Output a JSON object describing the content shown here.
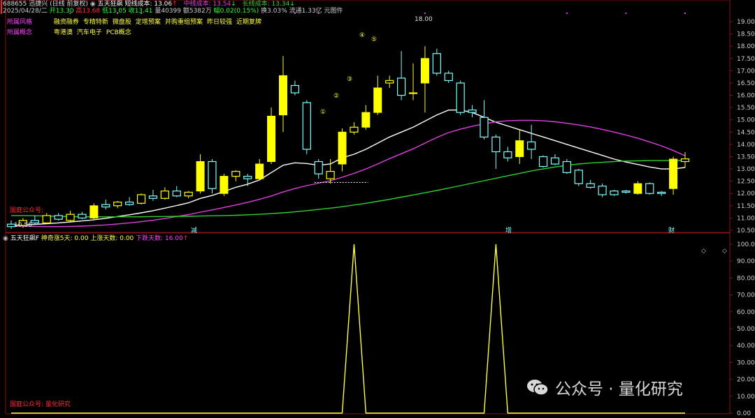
{
  "header": {
    "code_name": "688655 迅捷兴 (日线 前复权)",
    "indicator": "五天狂飙",
    "line_label": "短线成本: 13.06",
    "line_label_arrow": "↑",
    "mid_label": "中线成本: 13.54",
    "mid_arrow": "↓",
    "long_label": "长线成本: 13.34",
    "long_arrow": "↓",
    "date": "2025/04/28/二",
    "open": "开13.30",
    "high": "高13.68",
    "low": "低13.05",
    "close": "收13.41",
    "volume": "量40399",
    "amount": "额5382万",
    "change": "幅0.02(0.15%)",
    "turnover": "换3.03%",
    "float_cap": "流通1.33亿 元图件"
  },
  "tags": {
    "style_label": "所属风格",
    "style_items": [
      "融资融券",
      "专精特新",
      "微盘股",
      "定增预案",
      "并购重组预案",
      "昨日较强",
      "近期复牌"
    ],
    "concept_label": "所属概念",
    "concept_items": [
      "粤港澳",
      "汽车电子",
      "PCB概念"
    ]
  },
  "sub_header": {
    "title": "五天狂飙F",
    "f1": "神奇涨5天: 0.00",
    "f2": "上涨天数: 0.00",
    "f3": "下跌天数: 16.00",
    "f3_arrow": "↑"
  },
  "annotations": {
    "peak_price": "18.00",
    "low_price": "10.56",
    "left_watermark": "国庭公众号:",
    "marker_a": "减",
    "marker_b": "增",
    "marker_c": "财",
    "sub_footer": "国庭公众号: 量化研究",
    "watermark": "公众号 · 量化研究",
    "nav_left": "◇",
    "nav_right": "◇",
    "circled_1": "①",
    "circled_2": "②",
    "circled_3": "③",
    "circled_4": "④",
    "circled_5": "⑤"
  },
  "colors": {
    "up": "#ffff00",
    "down": "#7fffff",
    "short_line": "#ffffff",
    "mid_line": "#e040e0",
    "long_line": "#30d030",
    "sub_line": "#ffff40",
    "axis_text": "#cfcfcf",
    "tag_label": "#ff40ff",
    "tag_text": "#ffff40",
    "grid": "#8a1010"
  },
  "chart_data": [
    {
      "type": "candlestick",
      "title": "688655 迅捷兴 (日线 前复权)",
      "ylim": [
        10.5,
        19.2
      ],
      "y_ticks": [
        10.5,
        11.0,
        11.5,
        12.0,
        12.5,
        13.0,
        13.5,
        14.0,
        14.5,
        15.0,
        15.5,
        16.0,
        16.5,
        17.0,
        17.5,
        18.0,
        18.5,
        19.0
      ],
      "y_tick_labels": [
        "10.50",
        "11.00",
        "11.50",
        "12.00",
        "12.50",
        "13.00",
        "13.50",
        "14.00",
        "14.50",
        "15.00",
        "15.50",
        "16.00",
        "16.50",
        "17.00",
        "17.50",
        "18.00",
        "18.50",
        "19.00"
      ],
      "ohlc": [
        {
          "o": 10.75,
          "h": 10.9,
          "l": 10.56,
          "c": 10.65
        },
        {
          "o": 10.7,
          "h": 11.0,
          "l": 10.6,
          "c": 10.9
        },
        {
          "o": 10.9,
          "h": 11.1,
          "l": 10.75,
          "c": 10.8
        },
        {
          "o": 10.8,
          "h": 11.2,
          "l": 10.75,
          "c": 11.1
        },
        {
          "o": 11.1,
          "h": 11.2,
          "l": 10.9,
          "c": 10.95
        },
        {
          "o": 10.9,
          "h": 11.3,
          "l": 10.85,
          "c": 11.15
        },
        {
          "o": 11.15,
          "h": 11.25,
          "l": 10.95,
          "c": 11.0
        },
        {
          "o": 11.0,
          "h": 11.6,
          "l": 10.95,
          "c": 11.5
        },
        {
          "o": 11.55,
          "h": 11.75,
          "l": 11.35,
          "c": 11.45
        },
        {
          "o": 11.5,
          "h": 11.7,
          "l": 11.4,
          "c": 11.65
        },
        {
          "o": 11.65,
          "h": 11.85,
          "l": 11.5,
          "c": 11.55
        },
        {
          "o": 11.6,
          "h": 12.0,
          "l": 11.55,
          "c": 11.95
        },
        {
          "o": 11.9,
          "h": 12.15,
          "l": 11.7,
          "c": 11.8
        },
        {
          "o": 11.8,
          "h": 12.25,
          "l": 11.75,
          "c": 12.1
        },
        {
          "o": 12.1,
          "h": 12.3,
          "l": 11.85,
          "c": 11.9
        },
        {
          "o": 11.9,
          "h": 12.1,
          "l": 11.8,
          "c": 12.05
        },
        {
          "o": 12.1,
          "h": 13.6,
          "l": 12.0,
          "c": 13.3
        },
        {
          "o": 13.3,
          "h": 13.4,
          "l": 12.0,
          "c": 12.2
        },
        {
          "o": 12.0,
          "h": 12.8,
          "l": 11.9,
          "c": 12.7
        },
        {
          "o": 12.7,
          "h": 12.95,
          "l": 12.5,
          "c": 12.9
        },
        {
          "o": 12.7,
          "h": 12.8,
          "l": 12.3,
          "c": 12.6
        },
        {
          "o": 12.6,
          "h": 13.4,
          "l": 12.55,
          "c": 13.2
        },
        {
          "o": 13.3,
          "h": 15.5,
          "l": 13.2,
          "c": 15.15
        },
        {
          "o": 15.2,
          "h": 17.6,
          "l": 14.5,
          "c": 16.8
        },
        {
          "o": 16.4,
          "h": 16.6,
          "l": 16.0,
          "c": 16.1
        },
        {
          "o": 15.7,
          "h": 15.8,
          "l": 13.6,
          "c": 13.8
        },
        {
          "o": 13.3,
          "h": 13.4,
          "l": 12.6,
          "c": 12.8
        },
        {
          "o": 12.6,
          "h": 13.4,
          "l": 12.4,
          "c": 12.9
        },
        {
          "o": 13.2,
          "h": 14.65,
          "l": 12.9,
          "c": 14.5
        },
        {
          "o": 14.5,
          "h": 14.9,
          "l": 14.4,
          "c": 14.7
        },
        {
          "o": 14.7,
          "h": 15.6,
          "l": 14.6,
          "c": 15.3
        },
        {
          "o": 15.3,
          "h": 16.8,
          "l": 15.2,
          "c": 16.3
        },
        {
          "o": 16.5,
          "h": 16.8,
          "l": 16.3,
          "c": 16.6
        },
        {
          "o": 16.7,
          "h": 17.8,
          "l": 15.8,
          "c": 16.0
        },
        {
          "o": 16.1,
          "h": 17.3,
          "l": 15.8,
          "c": 16.1
        },
        {
          "o": 16.5,
          "h": 18.0,
          "l": 15.3,
          "c": 17.5
        },
        {
          "o": 17.7,
          "h": 17.9,
          "l": 16.8,
          "c": 16.9
        },
        {
          "o": 16.9,
          "h": 17.0,
          "l": 16.5,
          "c": 16.6
        },
        {
          "o": 16.5,
          "h": 16.6,
          "l": 15.2,
          "c": 15.3
        },
        {
          "o": 15.4,
          "h": 15.6,
          "l": 15.1,
          "c": 15.3
        },
        {
          "o": 15.1,
          "h": 15.8,
          "l": 14.2,
          "c": 14.3
        },
        {
          "o": 14.3,
          "h": 14.4,
          "l": 13.0,
          "c": 13.7
        },
        {
          "o": 13.7,
          "h": 13.9,
          "l": 13.3,
          "c": 13.45
        },
        {
          "o": 13.5,
          "h": 14.6,
          "l": 13.2,
          "c": 14.15
        },
        {
          "o": 14.1,
          "h": 14.8,
          "l": 13.4,
          "c": 13.8
        },
        {
          "o": 13.5,
          "h": 13.55,
          "l": 13.05,
          "c": 13.1
        },
        {
          "o": 13.45,
          "h": 13.6,
          "l": 13.15,
          "c": 13.2
        },
        {
          "o": 13.3,
          "h": 13.4,
          "l": 12.8,
          "c": 12.85
        },
        {
          "o": 12.95,
          "h": 13.0,
          "l": 12.3,
          "c": 12.4
        },
        {
          "o": 12.4,
          "h": 12.55,
          "l": 12.2,
          "c": 12.25
        },
        {
          "o": 12.3,
          "h": 12.4,
          "l": 11.85,
          "c": 11.95
        },
        {
          "o": 12.1,
          "h": 12.15,
          "l": 11.9,
          "c": 11.95
        },
        {
          "o": 12.1,
          "h": 12.15,
          "l": 12.0,
          "c": 12.05
        },
        {
          "o": 12.0,
          "h": 12.5,
          "l": 11.95,
          "c": 12.4
        },
        {
          "o": 12.4,
          "h": 12.45,
          "l": 11.95,
          "c": 12.0
        },
        {
          "o": 12.05,
          "h": 12.1,
          "l": 11.9,
          "c": 12.0
        },
        {
          "o": 12.2,
          "h": 13.5,
          "l": 11.95,
          "c": 13.4
        },
        {
          "o": 13.3,
          "h": 13.68,
          "l": 13.05,
          "c": 13.41
        }
      ],
      "series": [
        {
          "name": "短线成本",
          "values": [
            10.7,
            10.72,
            10.74,
            10.77,
            10.8,
            10.84,
            10.88,
            10.93,
            10.99,
            11.06,
            11.13,
            11.21,
            11.3,
            11.4,
            11.51,
            11.62,
            11.8,
            11.92,
            12.08,
            12.25,
            12.38,
            12.55,
            12.85,
            13.15,
            13.25,
            13.22,
            13.15,
            13.2,
            13.45,
            13.6,
            13.8,
            14.05,
            14.3,
            14.5,
            14.7,
            14.95,
            15.2,
            15.4,
            15.4,
            15.3,
            15.1,
            14.9,
            14.75,
            14.6,
            14.45,
            14.3,
            14.15,
            14.0,
            13.85,
            13.7,
            13.55,
            13.4,
            13.28,
            13.18,
            13.08,
            13.0,
            13.0,
            13.06
          ]
        },
        {
          "name": "中线成本",
          "values": [
            10.68,
            10.67,
            10.66,
            10.65,
            10.65,
            10.66,
            10.67,
            10.69,
            10.72,
            10.76,
            10.8,
            10.85,
            10.91,
            10.98,
            11.06,
            11.14,
            11.24,
            11.33,
            11.43,
            11.53,
            11.64,
            11.76,
            11.9,
            12.06,
            12.2,
            12.32,
            12.42,
            12.52,
            12.66,
            12.82,
            13.0,
            13.2,
            13.42,
            13.62,
            13.82,
            14.05,
            14.28,
            14.48,
            14.62,
            14.74,
            14.84,
            14.92,
            14.96,
            14.98,
            14.98,
            14.96,
            14.92,
            14.86,
            14.79,
            14.71,
            14.61,
            14.5,
            14.38,
            14.25,
            14.1,
            13.94,
            13.75,
            13.54
          ]
        },
        {
          "name": "长线成本",
          "values": [
            11.1,
            11.1,
            11.09,
            11.08,
            11.07,
            11.06,
            11.05,
            11.05,
            11.05,
            11.05,
            11.05,
            11.05,
            11.06,
            11.06,
            11.07,
            11.07,
            11.08,
            11.09,
            11.1,
            11.11,
            11.13,
            11.15,
            11.18,
            11.21,
            11.25,
            11.3,
            11.35,
            11.4,
            11.46,
            11.53,
            11.6,
            11.68,
            11.76,
            11.85,
            11.94,
            12.03,
            12.12,
            12.22,
            12.32,
            12.42,
            12.52,
            12.62,
            12.72,
            12.82,
            12.92,
            13.0,
            13.08,
            13.14,
            13.2,
            13.24,
            13.27,
            13.3,
            13.32,
            13.33,
            13.34,
            13.34,
            13.34,
            13.34
          ]
        }
      ]
    },
    {
      "type": "line",
      "title": "五天狂飙F",
      "ylim": [
        0,
        100
      ],
      "y_ticks": [
        0,
        10,
        20,
        30,
        40,
        50,
        60,
        70,
        80,
        90,
        100
      ],
      "y_tick_labels": [
        "0.00",
        "10.00",
        "20.00",
        "30.00",
        "40.00",
        "50.00",
        "60.00",
        "70.00",
        "80.00",
        "90.00",
        "100.00"
      ],
      "series": [
        {
          "name": "神奇涨5天",
          "values": [
            0,
            0,
            0,
            0,
            0,
            0,
            0,
            0,
            0,
            0,
            0,
            0,
            0,
            0,
            0,
            0,
            0,
            0,
            0,
            0,
            0,
            0,
            0,
            0,
            0,
            0,
            0,
            0,
            0,
            100,
            0,
            0,
            0,
            0,
            0,
            0,
            0,
            0,
            0,
            0,
            0,
            100,
            0,
            0,
            0,
            0,
            0,
            0,
            0,
            0,
            0,
            0,
            0,
            0,
            0,
            0,
            0,
            0
          ]
        }
      ]
    }
  ]
}
